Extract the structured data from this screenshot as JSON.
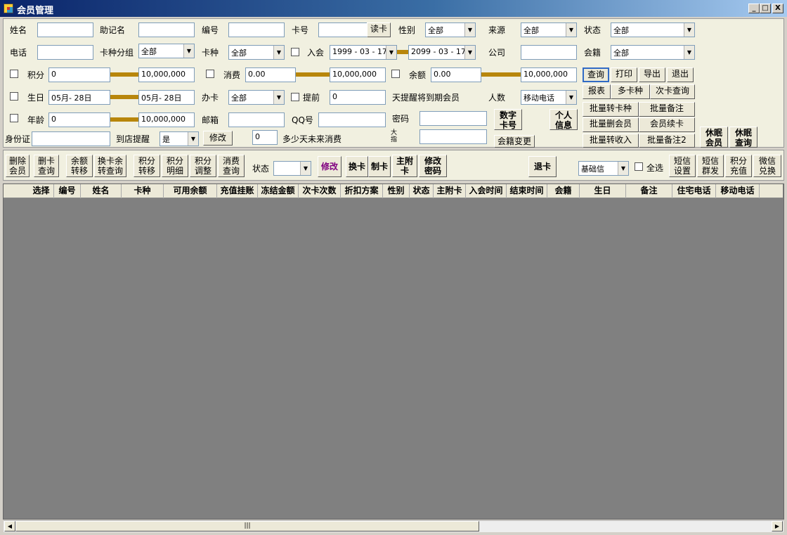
{
  "window": {
    "title": "会员管理",
    "min": "_",
    "max": "□",
    "close": "X"
  },
  "filters": {
    "name_label": "姓名",
    "mnemonic_label": "助记名",
    "code_label": "编号",
    "card_no_label": "卡号",
    "read_card": "读卡",
    "gender_label": "性别",
    "gender_value": "全部",
    "source_label": "来源",
    "source_value": "全部",
    "status_label": "状态",
    "status_value": "全部",
    "phone_label": "电话",
    "card_group_label": "卡种分组",
    "card_group_value": "全部",
    "card_type_label": "卡种",
    "card_type_value": "全部",
    "join_label": "入会",
    "join_from": "1999 - 03 - 17",
    "join_to": "2099 - 03 - 17",
    "company_label": "公司",
    "origin_label": "会籍",
    "origin_value": "全部",
    "points_label": "积分",
    "points_min": "0",
    "points_max": "10,000,000",
    "consume_label": "消费",
    "consume_min": "0.00",
    "consume_max": "10,000,000",
    "balance_label": "余额",
    "balance_min": "0.00",
    "balance_max": "10,000,000",
    "birthday_label": "生日",
    "birthday_from": "05月- 28日",
    "birthday_to": "05月- 28日",
    "issue_label": "办卡",
    "issue_value": "全部",
    "advance_label": "提前",
    "advance_value": "0",
    "expire_text": "天提醒将到期会员",
    "people_label": "人数",
    "people_value": "移动电话",
    "age_label": "年龄",
    "age_min": "0",
    "age_max": "10,000,000",
    "email_label": "邮箱",
    "qq_label": "QQ号",
    "password_label": "密码",
    "idcard_label": "身份证",
    "visit_label": "到店提醒",
    "visit_value": "是",
    "modify_btn": "修改",
    "days_value": "0",
    "days_text": "多少天未来消费",
    "vert_label": "大 指"
  },
  "right_buttons": {
    "query": "查询",
    "print": "打印",
    "export": "导出",
    "exit": "退出",
    "report": "报表",
    "multi_card": "多卡种",
    "times_query": "次卡查询",
    "digit_card": "数字\n卡号",
    "personal": "个人\n信息",
    "batch_card": "批量转卡种",
    "batch_note": "批量备注",
    "batch_delete": "批量删会员",
    "renew": "会员续卡",
    "origin_change": "会籍变更",
    "batch_income": "批量转收入",
    "batch_note2": "批量备注2",
    "sleep_member": "休眠\n会员",
    "sleep_query": "休眠\n查询"
  },
  "toolbar": {
    "delete_member": "删除\n会员",
    "delete_card_query": "删卡\n查询",
    "balance_transfer": "余额\n转移",
    "swap_balance": "换卡余\n转查询",
    "points_transfer": "积分\n转移",
    "points_detail": "积分\n明细",
    "points_adjust": "积分\n调整",
    "consume_query": "消费\n查询",
    "status_label": "状态",
    "status_value": "",
    "modify": "修改",
    "swap_card": "换卡",
    "make_card": "制卡",
    "main_sub_card": "主附\n卡",
    "change_pwd": "修改\n密码",
    "refund_card": "退卡",
    "basic_info": "基础信",
    "select_all": "全选",
    "sms_settings": "短信\n设置",
    "sms_group": "短信\n群发",
    "points_recharge": "积分\n充值",
    "wechat_redeem": "微信\n兑换"
  },
  "table": {
    "columns": [
      "选择",
      "编号",
      "姓名",
      "卡种",
      "可用余额",
      "充值挂账",
      "冻结金额",
      "次卡次数",
      "折扣方案",
      "性别",
      "状态",
      "主附卡",
      "入会时间",
      "结束时间",
      "会籍",
      "生日",
      "备注",
      "住宅电话",
      "移动电话"
    ]
  },
  "scrollbar": {
    "grip": "|||"
  }
}
